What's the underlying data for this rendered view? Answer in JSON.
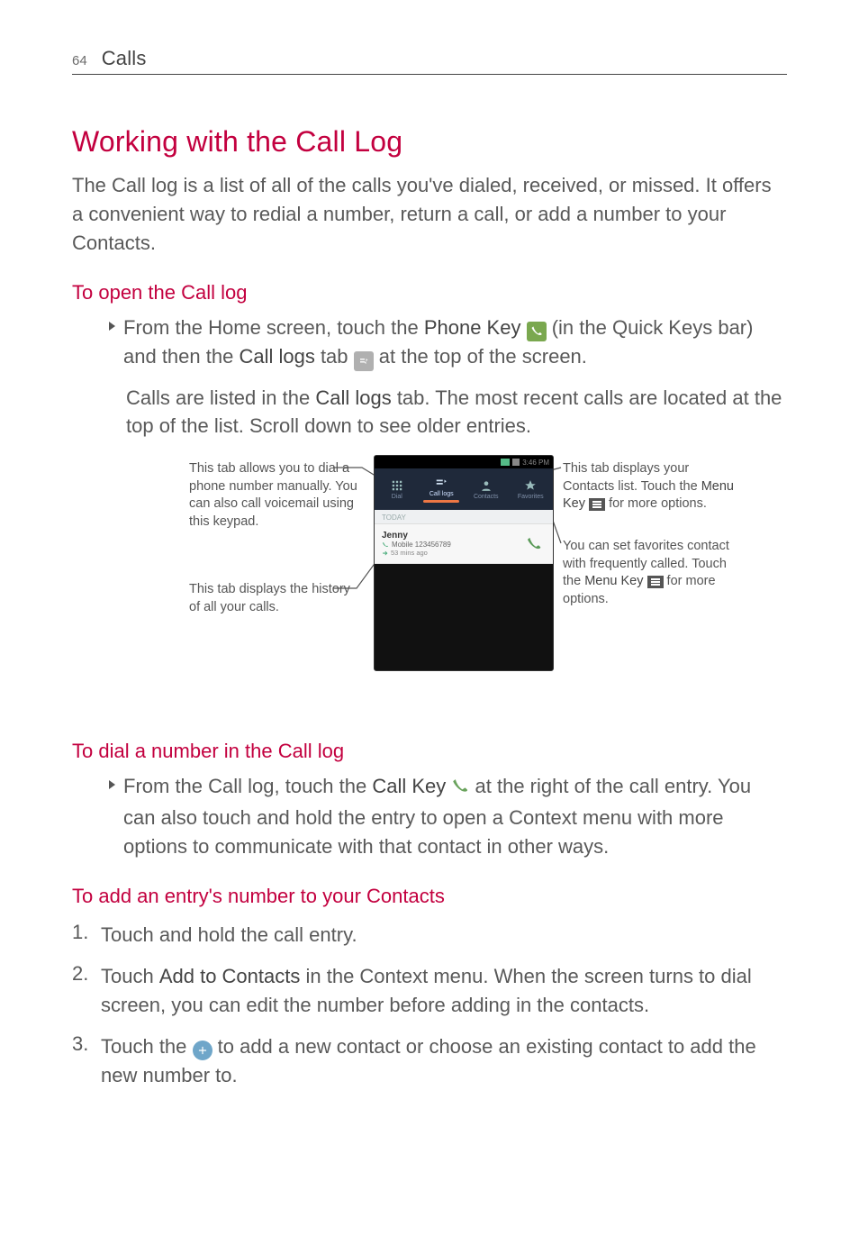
{
  "header": {
    "page_number": "64",
    "section": "Calls"
  },
  "h1": "Working with the Call Log",
  "intro": "The Call log is a list of all of the calls you've dialed, received, or missed. It offers a convenient way to redial a number, return a call, or add a number to your Contacts.",
  "sec_open": {
    "title": "To open the Call log",
    "b1_a": "From the Home screen, touch the ",
    "b1_phone_key": "Phone Key",
    "b1_b": " (in the Quick Keys bar) and then the ",
    "b1_call_logs": "Call logs",
    "b1_c": " tab ",
    "b1_d": " at the top of the screen.",
    "p2_a": "Calls are listed in the ",
    "p2_call_logs": "Call logs",
    "p2_b": " tab. The most recent calls are located at the top of the list. Scroll down to see older entries."
  },
  "figure": {
    "callout_dial": "This tab allows you to dial a phone number manually. You can also call voicemail using this keypad.",
    "callout_history": "This tab displays the history of all your calls.",
    "callout_contacts_a": "This tab displays your Contacts list. Touch the ",
    "callout_contacts_menu": "Menu Key",
    "callout_contacts_b": " for more options.",
    "callout_fav_a": "You can set favorites contact with frequently called. Touch the ",
    "callout_fav_menu": "Menu Key",
    "callout_fav_b": " for more options.",
    "phone": {
      "time": "3:46 PM",
      "tab_dial": "Dial",
      "tab_logs": "Call logs",
      "tab_contacts": "Contacts",
      "tab_favorites": "Favorites",
      "today": "TODAY",
      "entry_name": "Jenny",
      "entry_number": "Mobile 123456789",
      "entry_time": "53 mins ago"
    }
  },
  "sec_dial": {
    "title": "To dial a number in the Call log",
    "b1_a": "From the Call log, touch the ",
    "b1_call_key": "Call Key",
    "b1_b": " at the right of the call entry. You can also touch and hold the entry to open a Context menu with more options to communicate with that contact in other ways."
  },
  "sec_add": {
    "title": "To add an entry's number to your Contacts",
    "step1": "Touch and hold the call entry.",
    "step2_a": "Touch ",
    "step2_b": "Add to Contacts",
    "step2_c": " in the Context menu. When the screen turns to dial screen, you can edit the number before adding in the contacts.",
    "step3_a": "Touch the ",
    "step3_b": " to add a new contact or choose an existing contact to add the new number to."
  }
}
